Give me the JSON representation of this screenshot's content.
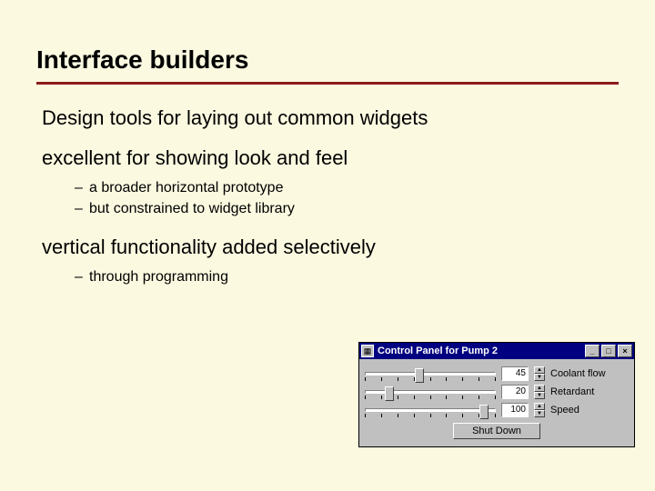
{
  "title": "Interface builders",
  "p1": "Design tools for laying out common widgets",
  "p2": "excellent for showing look and feel",
  "p2_items": [
    "a broader horizontal prototype",
    "but constrained to widget library"
  ],
  "p3": "vertical functionality added selectively",
  "p3_items": [
    "through programming"
  ],
  "panel": {
    "caption": "Control Panel for Pump 2",
    "rows": [
      {
        "value": "45",
        "label": "Coolant flow",
        "thumb_pct": 38
      },
      {
        "value": "20",
        "label": "Retardant",
        "thumb_pct": 15
      },
      {
        "value": "100",
        "label": "Speed",
        "thumb_pct": 88
      }
    ],
    "shutdown": "Shut Down"
  },
  "glyphs": {
    "min": "_",
    "max": "□",
    "close": "×",
    "up": "▲",
    "down": "▼"
  }
}
